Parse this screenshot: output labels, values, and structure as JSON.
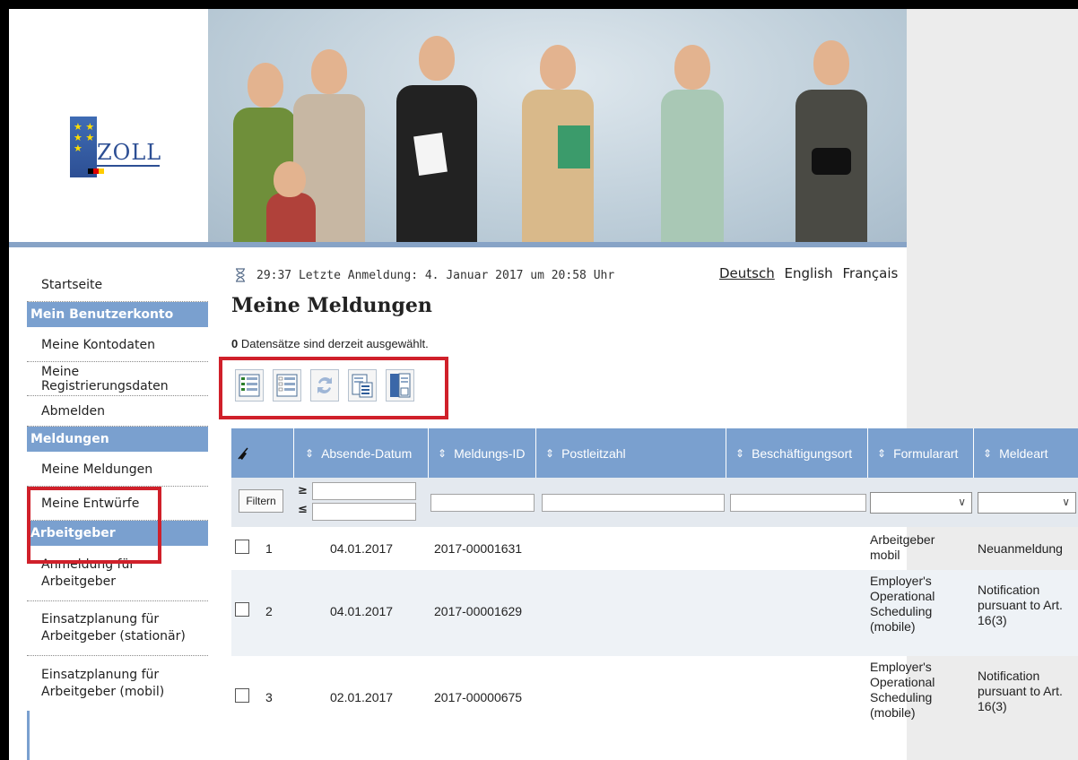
{
  "logo": {
    "text": "ZOLL"
  },
  "status": {
    "timer": "29:37",
    "last_login": "Letzte Anmeldung: 4. Januar 2017 um 20:58 Uhr"
  },
  "languages": [
    {
      "label": "Deutsch",
      "active": true
    },
    {
      "label": "English",
      "active": false
    },
    {
      "label": "Français",
      "active": false
    }
  ],
  "page": {
    "title": "Meine Meldungen",
    "selected_count": "0",
    "selected_text": "Datensätze sind derzeit ausgewählt."
  },
  "sidebar": {
    "home": "Startseite",
    "account_header": "Mein Benutzerkonto",
    "account_items": [
      "Meine Kontodaten",
      "Meine Registrierungsdaten",
      "Abmelden"
    ],
    "reports_header": "Meldungen",
    "reports_items": [
      "Meine Meldungen",
      "Meine Entwürfe"
    ],
    "employer_header": "Arbeitgeber",
    "employer_items": [
      "Anmeldung für Arbeitgeber",
      "Einsatzplanung für Arbeitgeber (stationär)",
      "Einsatzplanung für Arbeitgeber (mobil)"
    ]
  },
  "toolbar": {
    "icons": [
      "select-all-icon",
      "deselect-all-icon",
      "refresh-icon",
      "export-icon",
      "report-view-icon"
    ]
  },
  "table": {
    "headers": [
      "Absende-Datum",
      "Meldungs-ID",
      "Postleitzahl",
      "Beschäftigungsort",
      "Formularart",
      "Meldeart"
    ],
    "filter_button": "Filtern",
    "ge_symbol": "≥",
    "le_symbol": "≤",
    "rows": [
      {
        "num": "1",
        "date": "04.01.2017",
        "id": "2017-00001631",
        "plz": "",
        "ort": "",
        "form": "Arbeitgeber mobil",
        "type": "Neuanmeldung"
      },
      {
        "num": "2",
        "date": "04.01.2017",
        "id": "2017-00001629",
        "plz": "",
        "ort": "",
        "form": "Employer's Operational Scheduling (mobile)",
        "type": "Notification pursuant to Art. 16(3)"
      },
      {
        "num": "3",
        "date": "02.01.2017",
        "id": "2017-00000675",
        "plz": "",
        "ort": "",
        "form": "Employer's Operational Scheduling (mobile)",
        "type": "Notification pursuant to Art. 16(3)"
      }
    ]
  },
  "colors": {
    "nav_blue": "#7aa0cf",
    "highlight_red": "#d0202a"
  }
}
